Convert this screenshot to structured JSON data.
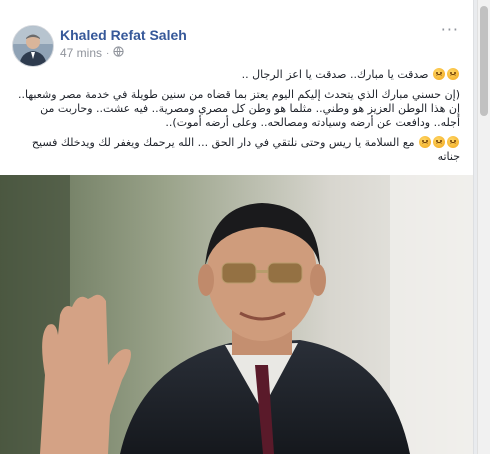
{
  "post": {
    "author": "Khaled Refat Saleh",
    "time": "47 mins",
    "privacy_icon": "globe-icon",
    "more_icon": "ellipsis-icon",
    "lines": [
      "صدقت يا مبارك.. صدقت يا اعز الرجال ..",
      "(إن حسني مبارك الذي يتحدث إليكم اليوم يعتز بما قضاه من سنين طويلة في خدمة مصر وشعبها.. إن هذا الوطن العزيز هو وطني.. مثلما هو وطن كل مصري ومصرية.. فيه عشت.. وحاربت من أجله.. ودافعت عن أرضه وسيادته ومصالحه.. وعلى أرضه أموت)..",
      "مع السلامة يا ريس وحتى نلتقي في دار الحق ... الله يرحمك ويغفر لك ويدخلك فسيح جناته"
    ],
    "emoji_icon": "crying-face-icon",
    "photo_alt_icon": "person-waving-photo"
  },
  "colors": {
    "author": "#365899",
    "meta": "#90949c",
    "text": "#1d2129",
    "background": "#e9ebee"
  }
}
